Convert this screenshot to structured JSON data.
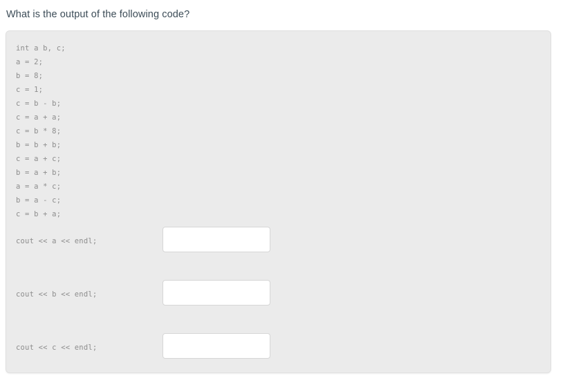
{
  "question": {
    "heading": "What is the output of the following code?"
  },
  "code": {
    "lines": [
      "int a b, c;",
      "a = 2;",
      "b = 8;",
      "c = 1;",
      "c = b - b;",
      "c = a + a;",
      "c = b * 8;",
      "b = b + b;",
      "c = a + c;",
      "b = a + b;",
      "a = a * c;",
      "b = a - c;",
      "c = b + a;"
    ]
  },
  "outputs": [
    {
      "statement": "cout << a << endl;",
      "value": "",
      "placeholder": ""
    },
    {
      "statement": "cout << b << endl;",
      "value": "",
      "placeholder": ""
    },
    {
      "statement": "cout << c << endl;",
      "value": "",
      "placeholder": ""
    }
  ],
  "colors": {
    "page_background": "#ffffff",
    "panel_background": "#ebebeb",
    "panel_border": "#e0e0e0",
    "heading_text": "#3c4c57",
    "code_text": "#8d8d8d",
    "input_background": "#ffffff",
    "input_border": "#d6d6d6"
  }
}
